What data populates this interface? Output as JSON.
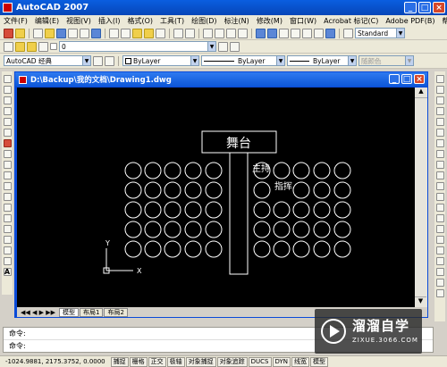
{
  "app": {
    "title": "AutoCAD 2007"
  },
  "menu": [
    "文件(F)",
    "编辑(E)",
    "视图(V)",
    "插入(I)",
    "格式(O)",
    "工具(T)",
    "绘图(D)",
    "标注(N)",
    "修改(M)",
    "窗口(W)",
    "Acrobat 标记(C)",
    "Adobe PDF(B)",
    "帮助(H)"
  ],
  "toolbar": {
    "style_value": "Standard",
    "layer_value": "0",
    "workspace_value": "AutoCAD 经典",
    "color_value": "ByLayer",
    "linetype_value": "ByLayer",
    "lineweight_value": "ByLayer",
    "plotstyle_value": "随颜色"
  },
  "document": {
    "title": "D:\\Backup\\我的文档\\Drawing1.dwg"
  },
  "drawing": {
    "stage_label": "舞台",
    "host_label": "主持",
    "conductor_label": "指挥",
    "ucs_x": "X",
    "ucs_y": "Y"
  },
  "layout_tabs": [
    "模型",
    "布局1",
    "布局2"
  ],
  "command_lines": [
    "命令:",
    "命令:"
  ],
  "status": {
    "coords": "-1024.9881, 2175.3752, 0.0000",
    "buttons": [
      "捕捉",
      "栅格",
      "正交",
      "极轴",
      "对象捕捉",
      "对象追踪",
      "DUCS",
      "DYN",
      "线宽",
      "模型"
    ]
  },
  "watermark": {
    "brand": "溜溜自学",
    "url": "ZIXUE.3066.COM"
  }
}
